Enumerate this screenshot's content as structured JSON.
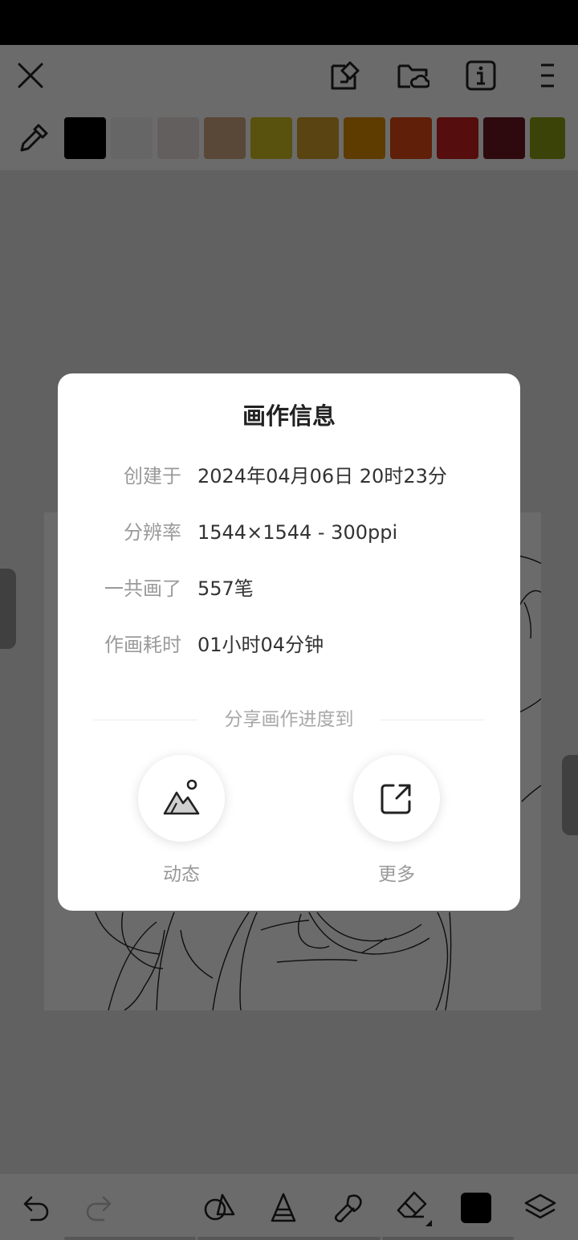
{
  "toolbar": {
    "close_icon": "close-icon",
    "canvas_icon": "canvas-edit-icon",
    "cloud_folder_icon": "cloud-folder-icon",
    "info_icon": "info-icon",
    "menu_icon": "menu-icon"
  },
  "palette": {
    "eyedropper_icon": "eyedropper-icon",
    "swatches": [
      "#000000",
      "#f4f4f4",
      "#ede3df",
      "#d3ab83",
      "#d5c122",
      "#d5a32d",
      "#e09000",
      "#e24a14",
      "#cb1f1f",
      "#6e1823",
      "#8fa014"
    ]
  },
  "dialog": {
    "title": "画作信息",
    "rows": [
      {
        "label": "创建于",
        "value": "2024年04月06日 20时23分"
      },
      {
        "label": "分辨率",
        "value": "1544×1544 - 300ppi"
      },
      {
        "label": "一共画了",
        "value": "557笔"
      },
      {
        "label": "作画耗时",
        "value": "01小时04分钟"
      }
    ],
    "share_heading": "分享画作进度到",
    "share_targets": [
      {
        "label": "动态",
        "icon": "mountain-image-icon"
      },
      {
        "label": "更多",
        "icon": "external-share-icon"
      }
    ]
  },
  "bottom_toolbar": {
    "tools": [
      "undo-icon",
      "redo-icon",
      "shapes-icon",
      "brush-cone-icon",
      "smudge-icon",
      "eraser-icon",
      "color-icon",
      "layers-icon"
    ],
    "current_color": "#000000"
  }
}
